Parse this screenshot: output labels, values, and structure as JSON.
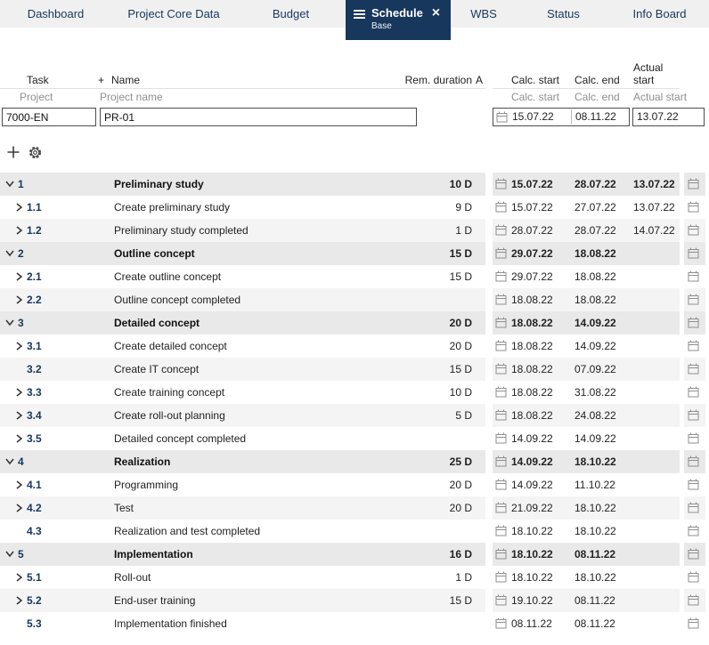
{
  "nav": {
    "tabs": [
      {
        "label": "Dashboard"
      },
      {
        "label": "Project Core Data"
      },
      {
        "label": "Budget"
      },
      {
        "label": "Schedule",
        "active": true,
        "sublabel": "Base"
      },
      {
        "label": "WBS"
      },
      {
        "label": "Status"
      },
      {
        "label": "Info Board"
      }
    ],
    "active_tab": "Schedule"
  },
  "icons": {
    "close": "×",
    "menu": "hamburger",
    "add": "+",
    "settings": "gear",
    "date_picker": "calendar",
    "collapsed": "chevron-right",
    "expanded": "chevron-down"
  },
  "table": {
    "left_headers": {
      "task": "Task",
      "plus": "+",
      "name": "Name",
      "rem_duration": "Rem. duration",
      "a": "A"
    },
    "left_filters": {
      "task": "Project",
      "name": "Project name"
    },
    "right_headers": {
      "calc_start": "Calc. start",
      "calc_end": "Calc. end",
      "actual_start": "Actual start"
    },
    "right_filters": {
      "calc_start": "Calc. start",
      "calc_end": "Calc. end",
      "actual_start": "Actual start"
    },
    "project_row": {
      "id": "7000-EN",
      "name": "PR-01",
      "calc_start": "15.07.22",
      "calc_end": "08.11.22",
      "actual_start": "13.07.22"
    }
  },
  "tasks": [
    {
      "num": "1",
      "name": "Preliminary study",
      "dur": "10 D",
      "calc_start": "15.07.22",
      "calc_end": "28.07.22",
      "actual_start": "13.07.22",
      "level": 1,
      "chevron": "down"
    },
    {
      "num": "1.1",
      "name": "Create preliminary study",
      "dur": "9 D",
      "calc_start": "15.07.22",
      "calc_end": "27.07.22",
      "actual_start": "13.07.22",
      "level": 2,
      "chevron": "right"
    },
    {
      "num": "1.2",
      "name": "Preliminary study completed",
      "dur": "1 D",
      "calc_start": "28.07.22",
      "calc_end": "28.07.22",
      "actual_start": "14.07.22",
      "level": 2,
      "chevron": "right"
    },
    {
      "num": "2",
      "name": "Outline concept",
      "dur": "15 D",
      "calc_start": "29.07.22",
      "calc_end": "18.08.22",
      "actual_start": "",
      "level": 1,
      "chevron": "down"
    },
    {
      "num": "2.1",
      "name": "Create outline concept",
      "dur": "15 D",
      "calc_start": "29.07.22",
      "calc_end": "18.08.22",
      "actual_start": "",
      "level": 2,
      "chevron": "right"
    },
    {
      "num": "2.2",
      "name": "Outline concept completed",
      "dur": "",
      "calc_start": "18.08.22",
      "calc_end": "18.08.22",
      "actual_start": "",
      "level": 2,
      "chevron": "right"
    },
    {
      "num": "3",
      "name": "Detailed concept",
      "dur": "20 D",
      "calc_start": "18.08.22",
      "calc_end": "14.09.22",
      "actual_start": "",
      "level": 1,
      "chevron": "down"
    },
    {
      "num": "3.1",
      "name": "Create detailed concept",
      "dur": "20 D",
      "calc_start": "18.08.22",
      "calc_end": "14.09.22",
      "actual_start": "",
      "level": 2,
      "chevron": "right"
    },
    {
      "num": "3.2",
      "name": "Create IT concept",
      "dur": "15 D",
      "calc_start": "18.08.22",
      "calc_end": "07.09.22",
      "actual_start": "",
      "level": 2,
      "chevron": "none"
    },
    {
      "num": "3.3",
      "name": "Create training concept",
      "dur": "10 D",
      "calc_start": "18.08.22",
      "calc_end": "31.08.22",
      "actual_start": "",
      "level": 2,
      "chevron": "right"
    },
    {
      "num": "3.4",
      "name": "Create roll-out planning",
      "dur": "5 D",
      "calc_start": "18.08.22",
      "calc_end": "24.08.22",
      "actual_start": "",
      "level": 2,
      "chevron": "right"
    },
    {
      "num": "3.5",
      "name": "Detailed concept completed",
      "dur": "",
      "calc_start": "14.09.22",
      "calc_end": "14.09.22",
      "actual_start": "",
      "level": 2,
      "chevron": "right"
    },
    {
      "num": "4",
      "name": "Realization",
      "dur": "25 D",
      "calc_start": "14.09.22",
      "calc_end": "18.10.22",
      "actual_start": "",
      "level": 1,
      "chevron": "down"
    },
    {
      "num": "4.1",
      "name": "Programming",
      "dur": "20 D",
      "calc_start": "14.09.22",
      "calc_end": "11.10.22",
      "actual_start": "",
      "level": 2,
      "chevron": "right"
    },
    {
      "num": "4.2",
      "name": "Test",
      "dur": "20 D",
      "calc_start": "21.09.22",
      "calc_end": "18.10.22",
      "actual_start": "",
      "level": 2,
      "chevron": "right"
    },
    {
      "num": "4.3",
      "name": "Realization and test completed",
      "dur": "",
      "calc_start": "18.10.22",
      "calc_end": "18.10.22",
      "actual_start": "",
      "level": 2,
      "chevron": "none"
    },
    {
      "num": "5",
      "name": "Implementation",
      "dur": "16 D",
      "calc_start": "18.10.22",
      "calc_end": "08.11.22",
      "actual_start": "",
      "level": 1,
      "chevron": "down"
    },
    {
      "num": "5.1",
      "name": "Roll-out",
      "dur": "1 D",
      "calc_start": "18.10.22",
      "calc_end": "18.10.22",
      "actual_start": "",
      "level": 2,
      "chevron": "right"
    },
    {
      "num": "5.2",
      "name": "End-user training",
      "dur": "15 D",
      "calc_start": "19.10.22",
      "calc_end": "08.11.22",
      "actual_start": "",
      "level": 2,
      "chevron": "right"
    },
    {
      "num": "5.3",
      "name": "Implementation finished",
      "dur": "",
      "calc_start": "08.11.22",
      "calc_end": "08.11.22",
      "actual_start": "",
      "level": 2,
      "chevron": "none"
    }
  ],
  "colors": {
    "accent_navy": "#17375d",
    "nav_bg": "#f0f0f0",
    "active_tab_bg": "#17375d",
    "active_tab_text": "#ffffff",
    "group_row_bg": "#e9e9e9",
    "alt_row_bg": "#f4f4f4",
    "filter_text": "#8f8f8f",
    "input_border": "#4d4d4d"
  }
}
